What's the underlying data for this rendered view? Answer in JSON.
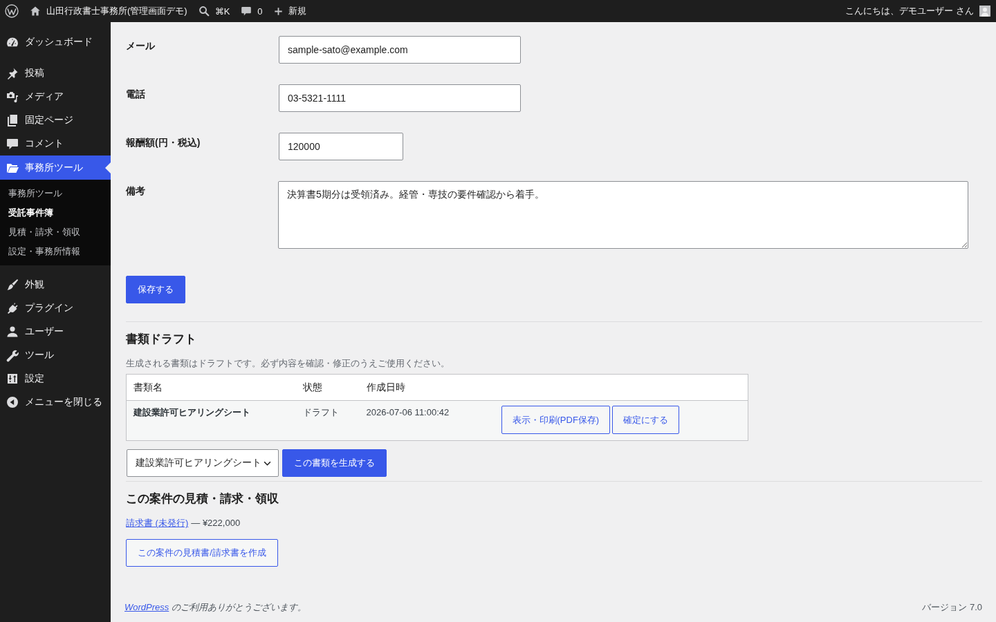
{
  "admin_bar": {
    "site_title": "山田行政書士事務所(管理画面デモ)",
    "search_shortcut": "⌘K",
    "comment_count": "0",
    "new_label": "新規",
    "greeting": "こんにちは、デモユーザー さん"
  },
  "sidebar": {
    "sections": [
      {
        "items": [
          {
            "label": "ダッシュボード",
            "selected": false
          }
        ]
      },
      {
        "items": [
          {
            "label": "投稿",
            "selected": false
          },
          {
            "label": "メディア",
            "selected": false
          },
          {
            "label": "固定ページ",
            "selected": false
          },
          {
            "label": "コメント",
            "selected": false
          },
          {
            "label": "事務所ツール",
            "selected": true,
            "children": [
              {
                "label": "事務所ツール",
                "selected": false
              },
              {
                "label": "受託事件簿",
                "selected": true
              },
              {
                "label": "見積・請求・領収",
                "selected": false
              },
              {
                "label": "設定・事務所情報",
                "selected": false
              }
            ]
          }
        ]
      },
      {
        "items": [
          {
            "label": "外観",
            "selected": false
          },
          {
            "label": "プラグイン",
            "selected": false
          },
          {
            "label": "ユーザー",
            "selected": false
          },
          {
            "label": "ツール",
            "selected": false
          },
          {
            "label": "設定",
            "selected": false
          }
        ]
      }
    ],
    "collapse_label": "メニューを閉じる"
  },
  "form": {
    "fields": [
      {
        "label": "メール",
        "kind": "text",
        "value": "sample-sato@example.com"
      },
      {
        "label": "電話",
        "kind": "text",
        "value": "03-5321-1111"
      },
      {
        "label": "報酬額(円・税込)",
        "kind": "number",
        "value": "120000"
      },
      {
        "label": "備考",
        "kind": "textarea",
        "value": "決算書5期分は受領済み。経管・専技の要件確認から着手。"
      }
    ],
    "save_button": "保存する"
  },
  "documents": {
    "title": "書類ドラフト",
    "description": "生成される書類はドラフトです。必ず内容を確認・修正のうえご使用ください。",
    "table": {
      "columns": [
        "書類名",
        "状態",
        "作成日時"
      ],
      "rows": [
        {
          "cells": [
            "建設業許可ヒアリングシート",
            "ドラフト",
            "2026-07-06 11:00:42"
          ],
          "actions": [
            "表示・印刷(PDF保存)",
            "確定にする"
          ]
        }
      ]
    },
    "template_select": "建設業許可ヒアリングシート",
    "generate_button": "この書類を生成する"
  },
  "billing": {
    "title": "この案件の見積・請求・領収",
    "entries": [
      {
        "link": "請求書 (未発行)",
        "amount": "— ¥222,000"
      }
    ],
    "create_button": "この案件の見積書/請求書を作成"
  },
  "footer": {
    "thanks_link": "WordPress",
    "thanks_text": "のご利用ありがとうございます。",
    "version": "バージョン 7.0"
  }
}
